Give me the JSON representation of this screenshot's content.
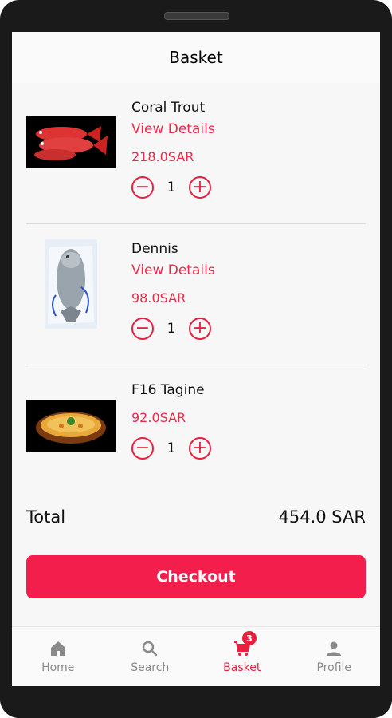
{
  "header": {
    "title": "Basket"
  },
  "items": [
    {
      "name": "Coral Trout",
      "details_label": "View Details",
      "price": "218.0SAR",
      "quantity": "1"
    },
    {
      "name": "Dennis",
      "details_label": "View Details",
      "price": "98.0SAR",
      "quantity": "1"
    },
    {
      "name": "F16 Tagine",
      "price": "92.0SAR",
      "quantity": "1"
    }
  ],
  "summary": {
    "total_label": "Total",
    "total_value": "454.0 SAR"
  },
  "checkout_label": "Checkout",
  "nav": {
    "home": "Home",
    "search": "Search",
    "basket": "Basket",
    "basket_badge": "3",
    "profile": "Profile"
  },
  "colors": {
    "accent": "#e8203e",
    "checkout": "#f41e4c"
  },
  "icons": {
    "minus": "minus-circle-icon",
    "plus": "plus-circle-icon",
    "home": "home-icon",
    "search": "search-icon",
    "basket": "cart-icon",
    "profile": "person-icon"
  }
}
